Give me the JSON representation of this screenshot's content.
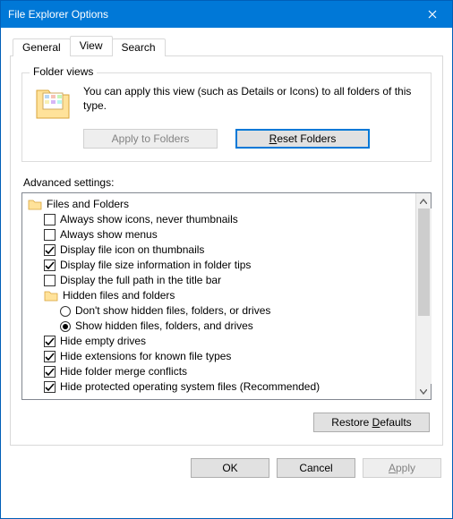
{
  "window": {
    "title": "File Explorer Options"
  },
  "tabs": {
    "general": "General",
    "view": "View",
    "search": "Search",
    "active": "view"
  },
  "folder_views": {
    "legend": "Folder views",
    "description": "You can apply this view (such as Details or Icons) to all folders of this type.",
    "apply_label": "Apply to Folders",
    "reset_label": "Reset Folders",
    "reset_underline_char": "R"
  },
  "advanced": {
    "label": "Advanced settings:",
    "root_label": "Files and Folders",
    "items": [
      {
        "kind": "check",
        "checked": false,
        "label": "Always show icons, never thumbnails"
      },
      {
        "kind": "check",
        "checked": false,
        "label": "Always show menus"
      },
      {
        "kind": "check",
        "checked": true,
        "label": "Display file icon on thumbnails"
      },
      {
        "kind": "check",
        "checked": true,
        "label": "Display file size information in folder tips"
      },
      {
        "kind": "check",
        "checked": false,
        "label": "Display the full path in the title bar"
      },
      {
        "kind": "group",
        "label": "Hidden files and folders"
      },
      {
        "kind": "radio",
        "selected": false,
        "label": "Don't show hidden files, folders, or drives"
      },
      {
        "kind": "radio",
        "selected": true,
        "label": "Show hidden files, folders, and drives"
      },
      {
        "kind": "check",
        "checked": true,
        "label": "Hide empty drives"
      },
      {
        "kind": "check",
        "checked": true,
        "label": "Hide extensions for known file types"
      },
      {
        "kind": "check",
        "checked": true,
        "label": "Hide folder merge conflicts"
      },
      {
        "kind": "check",
        "checked": true,
        "label": "Hide protected operating system files (Recommended)"
      }
    ],
    "restore_label": "Restore Defaults",
    "restore_underline_char": "D"
  },
  "buttons": {
    "ok": "OK",
    "cancel": "Cancel",
    "apply": "Apply",
    "apply_underline_char": "A",
    "apply_enabled": false
  }
}
